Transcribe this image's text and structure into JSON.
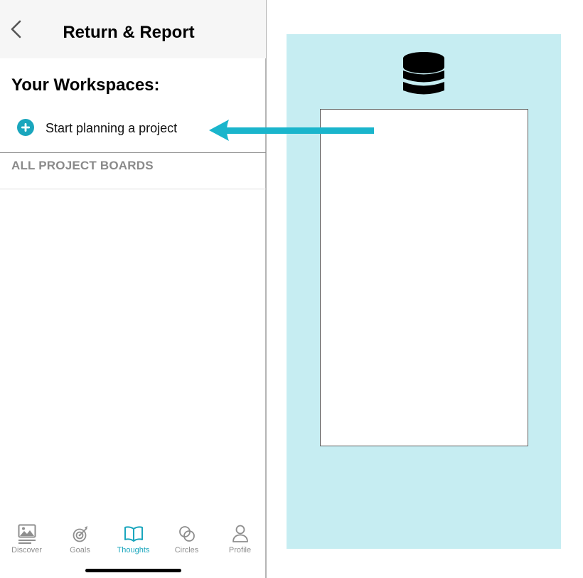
{
  "header": {
    "title": "Return & Report"
  },
  "workspaces": {
    "heading": "Your Workspaces:",
    "start_label": "Start planning a project",
    "boards_header": "ALL PROJECT BOARDS"
  },
  "tabs": [
    {
      "label": "Discover",
      "icon": "image-icon",
      "active": false
    },
    {
      "label": "Goals",
      "icon": "target-icon",
      "active": false
    },
    {
      "label": "Thoughts",
      "icon": "book-icon",
      "active": true
    },
    {
      "label": "Circles",
      "icon": "circles-icon",
      "active": false
    },
    {
      "label": "Profile",
      "icon": "person-icon",
      "active": false
    }
  ],
  "colors": {
    "accent": "#1aa6bd",
    "panel_bg": "#c6edf2",
    "arrow": "#1ab5cc"
  },
  "diagram": {
    "icon": "database-icon"
  }
}
